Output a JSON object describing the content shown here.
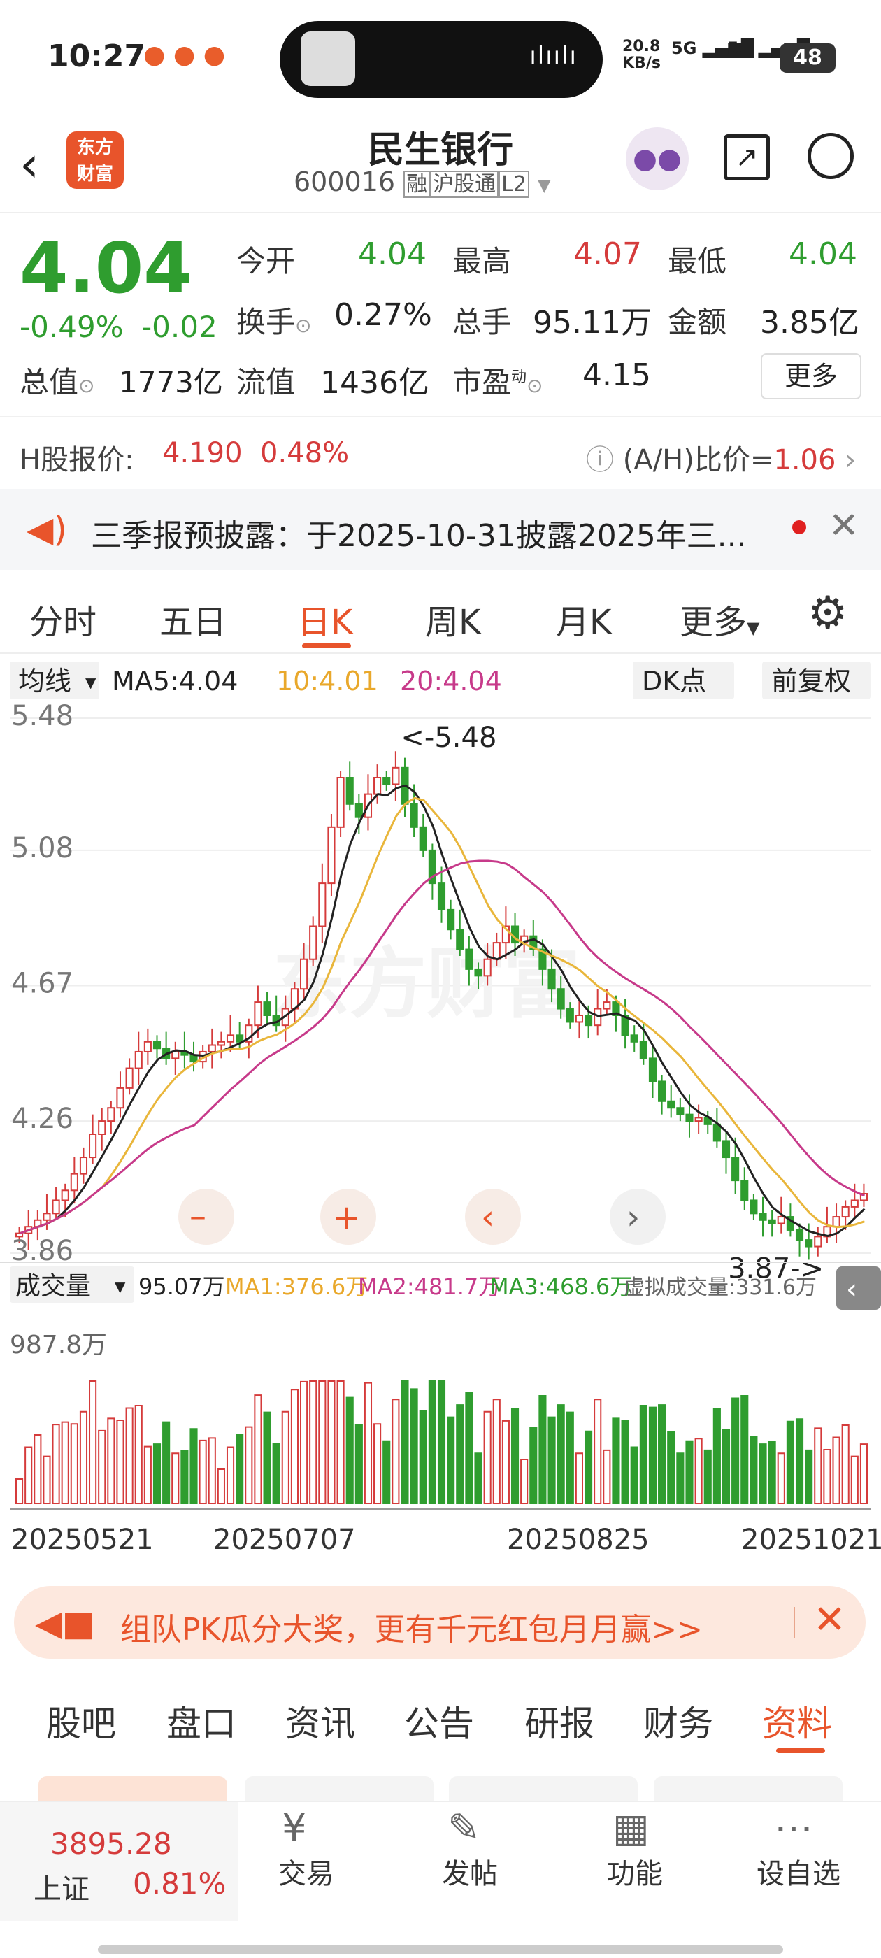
{
  "status_bar": {
    "time": "10:27",
    "net_speed": "20.8",
    "net_unit": "KB/s",
    "sig1": "5G",
    "sig2": "5G",
    "battery": "48"
  },
  "header": {
    "title": "民生银行",
    "code": "600016",
    "tag1": "融",
    "tag2": "沪股通",
    "tag3": "L2",
    "logo_line1": "东方",
    "logo_line2": "财富"
  },
  "quote": {
    "price": "4.04",
    "change_pct": "-0.49%",
    "change": "-0.02",
    "open_label": "今开",
    "open": "4.04",
    "high_label": "最高",
    "high": "4.07",
    "low_label": "最低",
    "low": "4.04",
    "turnover_label": "换手",
    "turnover": "0.27%",
    "volume_label": "总手",
    "volume": "95.11万",
    "amount_label": "金额",
    "amount": "3.85亿",
    "mktcap_label": "总值",
    "mktcap": "1773亿",
    "float_label": "流值",
    "float": "1436亿",
    "pe_label": "市盈",
    "pe_sup": "动",
    "pe": "4.15",
    "more": "更多"
  },
  "hshare": {
    "label": "H股报价:",
    "price": "4.190",
    "pct": "0.48%",
    "ah_label": "(A/H)比价=",
    "ah_value": "1.06"
  },
  "notice": {
    "text": "三季报预披露：于2025-10-31披露2025年三..."
  },
  "chart_tabs": [
    "分时",
    "五日",
    "日K",
    "周K",
    "月K",
    "更多"
  ],
  "ma_bar": {
    "select": "均线",
    "ma5": "MA5:4.04",
    "ma10": "10:4.01",
    "ma20": "20:4.04",
    "dk": "DK点",
    "fq": "前复权"
  },
  "chart_data": {
    "type": "candlestick",
    "y_ticks": [
      "5.48",
      "5.08",
      "4.67",
      "4.26",
      "3.86"
    ],
    "ylim": [
      3.86,
      5.48
    ],
    "max_label": "<-5.48",
    "min_label": "3.87->",
    "x_labels": [
      "20250521",
      "20250707",
      "20250825",
      "20251021"
    ],
    "volume_max_label": "987.8万",
    "closes": [
      3.92,
      3.94,
      3.96,
      3.98,
      4.02,
      4.05,
      4.1,
      4.15,
      4.22,
      4.26,
      4.3,
      4.36,
      4.42,
      4.47,
      4.5,
      4.48,
      4.45,
      4.47,
      4.46,
      4.44,
      4.47,
      4.49,
      4.5,
      4.52,
      4.5,
      4.55,
      4.62,
      4.58,
      4.55,
      4.6,
      4.66,
      4.75,
      4.85,
      4.98,
      5.15,
      5.3,
      5.22,
      5.18,
      5.25,
      5.3,
      5.28,
      5.33,
      5.22,
      5.15,
      5.08,
      4.98,
      4.9,
      4.84,
      4.78,
      4.72,
      4.7,
      4.75,
      4.8,
      4.85,
      4.8,
      4.82,
      4.78,
      4.72,
      4.66,
      4.6,
      4.56,
      4.58,
      4.55,
      4.6,
      4.62,
      4.58,
      4.52,
      4.5,
      4.45,
      4.38,
      4.32,
      4.3,
      4.28,
      4.26,
      4.27,
      4.25,
      4.2,
      4.15,
      4.08,
      4.02,
      3.98,
      3.96,
      3.95,
      3.97,
      3.93,
      3.9,
      3.88,
      3.91,
      3.94,
      3.97,
      4.0,
      4.02,
      4.04
    ]
  },
  "vol_bar": {
    "select": "成交量",
    "v": "95.07万",
    "ma1": "MA1:376.6万",
    "ma2": "MA2:481.7万",
    "ma3": "MA3:468.6万",
    "virt": "虚拟成交量:331.6万"
  },
  "banner": {
    "text": "组队PK瓜分大奖，更有千元红包月月赢>>"
  },
  "bottom_tabs": [
    "股吧",
    "盘口",
    "资讯",
    "公告",
    "研报",
    "财务",
    "资料"
  ],
  "bottom_nav": {
    "index_value": "3895.28",
    "index_name": "上证",
    "index_pct": "0.81%",
    "trade": "交易",
    "post": "发帖",
    "func": "功能",
    "fav": "设自选"
  },
  "colors": {
    "up": "#d53b3b",
    "down": "#2f9d2f",
    "accent": "#e8542b"
  }
}
